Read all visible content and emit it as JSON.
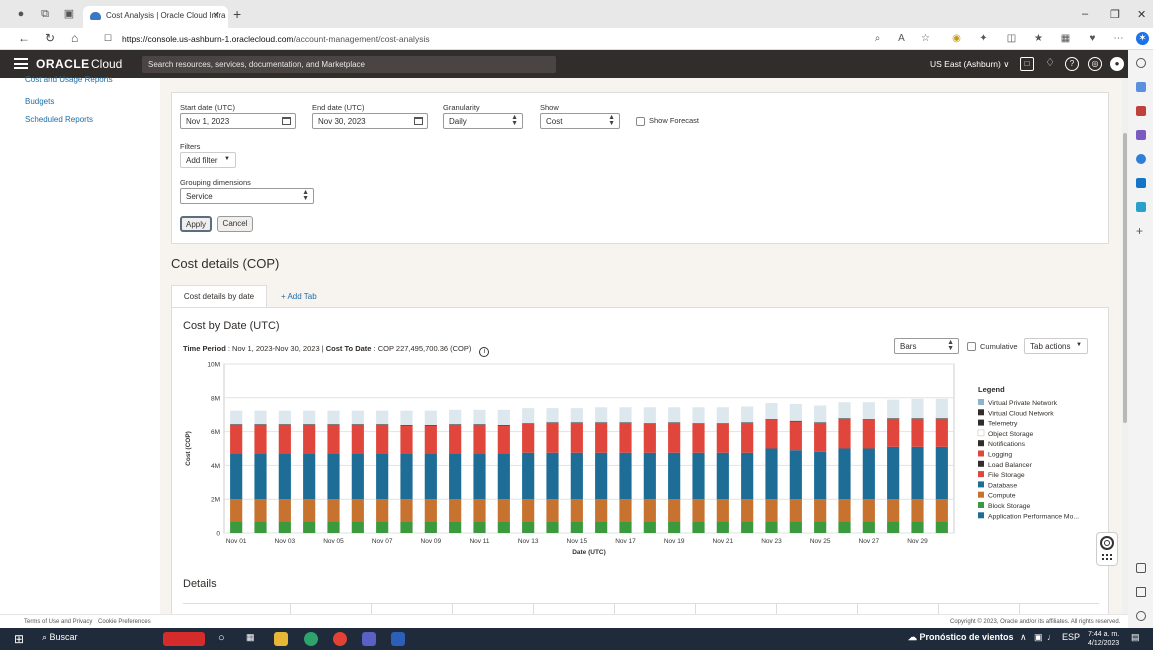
{
  "browser": {
    "tab_title": "Cost Analysis | Oracle Cloud Infra",
    "url_host": "https://console.us-ashburn-1.oraclecloud.com",
    "url_path": "/account-management/cost-analysis"
  },
  "header": {
    "brand": "ORACLE",
    "brand_suffix": "Cloud",
    "search_placeholder": "Search resources, services, documentation, and Marketplace",
    "region": "US East (Ashburn)"
  },
  "sidebar": {
    "items": [
      {
        "label": "Cost and Usage Reports"
      },
      {
        "label": "Budgets"
      },
      {
        "label": "Scheduled Reports"
      }
    ]
  },
  "filters": {
    "start_date_label": "Start date (UTC)",
    "start_date_value": "Nov 1, 2023",
    "end_date_label": "End date (UTC)",
    "end_date_value": "Nov 30, 2023",
    "granularity_label": "Granularity",
    "granularity_value": "Daily",
    "show_label": "Show",
    "show_value": "Cost",
    "show_forecast_label": "Show Forecast",
    "filters_label": "Filters",
    "add_filter_label": "Add filter",
    "grouping_label": "Grouping dimensions",
    "grouping_value": "Service",
    "apply_label": "Apply",
    "cancel_label": "Cancel"
  },
  "cost_details": {
    "title": "Cost details (COP)",
    "tab_label": "Cost details by date",
    "add_tab_label": "+ Add Tab",
    "chart_title": "Cost by Date (UTC)",
    "time_period_label": "Time Period",
    "time_period_value": ": Nov 1, 2023-Nov 30, 2023 |",
    "cost_to_date_label": "Cost To Date",
    "cost_to_date_value": ": COP 227,495,700.36 (COP)",
    "chart_type_value": "Bars",
    "cumulative_label": "Cumulative",
    "tab_actions_label": "Tab actions",
    "details_title": "Details"
  },
  "chart_data": {
    "type": "bar",
    "stacked": true,
    "title": "",
    "xlabel": "Date (UTC)",
    "ylabel": "Cost (COP)",
    "ylim": [
      0,
      10000000
    ],
    "yticks": [
      "0",
      "2M",
      "4M",
      "6M",
      "8M",
      "10M"
    ],
    "xtick_labels": [
      "Nov 01",
      "Nov 03",
      "Nov 05",
      "Nov 07",
      "Nov 09",
      "Nov 11",
      "Nov 13",
      "Nov 15",
      "Nov 17",
      "Nov 19",
      "Nov 21",
      "Nov 23",
      "Nov 25",
      "Nov 27",
      "Nov 29"
    ],
    "legend_title": "Legend",
    "legend_position": "right",
    "categories": [
      "Nov 01",
      "Nov 02",
      "Nov 03",
      "Nov 04",
      "Nov 05",
      "Nov 06",
      "Nov 07",
      "Nov 08",
      "Nov 09",
      "Nov 10",
      "Nov 11",
      "Nov 12",
      "Nov 13",
      "Nov 14",
      "Nov 15",
      "Nov 16",
      "Nov 17",
      "Nov 18",
      "Nov 19",
      "Nov 20",
      "Nov 21",
      "Nov 22",
      "Nov 23",
      "Nov 24",
      "Nov 25",
      "Nov 26",
      "Nov 27",
      "Nov 28",
      "Nov 29",
      "Nov 30"
    ],
    "series": [
      {
        "name": "Block Storage",
        "color": "#3c9a3e",
        "values": [
          700000,
          700000,
          700000,
          700000,
          700000,
          700000,
          700000,
          700000,
          700000,
          700000,
          700000,
          700000,
          700000,
          700000,
          700000,
          700000,
          700000,
          700000,
          700000,
          700000,
          700000,
          700000,
          700000,
          700000,
          700000,
          700000,
          700000,
          700000,
          700000,
          700000
        ]
      },
      {
        "name": "Compute",
        "color": "#c8722f",
        "values": [
          1300000,
          1300000,
          1300000,
          1300000,
          1300000,
          1300000,
          1300000,
          1300000,
          1300000,
          1300000,
          1300000,
          1300000,
          1300000,
          1300000,
          1300000,
          1300000,
          1300000,
          1300000,
          1300000,
          1300000,
          1300000,
          1300000,
          1300000,
          1300000,
          1300000,
          1300000,
          1300000,
          1300000,
          1300000,
          1300000
        ]
      },
      {
        "name": "Database",
        "color": "#1e6d97",
        "values": [
          2700000,
          2700000,
          2700000,
          2700000,
          2700000,
          2700000,
          2700000,
          2700000,
          2700000,
          2700000,
          2700000,
          2700000,
          2750000,
          2750000,
          2750000,
          2750000,
          2750000,
          2750000,
          2750000,
          2750000,
          2750000,
          2750000,
          3000000,
          2900000,
          2800000,
          3000000,
          3000000,
          3100000,
          3100000,
          3100000
        ]
      },
      {
        "name": "File Storage",
        "color": "#e0463b",
        "values": [
          1700000,
          1700000,
          1700000,
          1700000,
          1700000,
          1700000,
          1700000,
          1650000,
          1650000,
          1700000,
          1700000,
          1650000,
          1700000,
          1750000,
          1750000,
          1750000,
          1750000,
          1700000,
          1750000,
          1700000,
          1700000,
          1750000,
          1700000,
          1700000,
          1700000,
          1750000,
          1700000,
          1650000,
          1650000,
          1650000
        ]
      },
      {
        "name": "Load Balancer",
        "color": "#312d2a",
        "values": [
          40000,
          40000,
          40000,
          40000,
          40000,
          40000,
          40000,
          40000,
          40000,
          40000,
          40000,
          40000,
          40000,
          40000,
          40000,
          40000,
          40000,
          40000,
          40000,
          40000,
          40000,
          40000,
          40000,
          40000,
          40000,
          40000,
          40000,
          40000,
          40000,
          40000
        ]
      },
      {
        "name": "Virtual Private Network",
        "color": "#dde7ee",
        "values": [
          800000,
          800000,
          800000,
          800000,
          800000,
          800000,
          800000,
          850000,
          850000,
          850000,
          850000,
          900000,
          900000,
          850000,
          850000,
          900000,
          900000,
          950000,
          900000,
          950000,
          950000,
          950000,
          950000,
          1000000,
          1000000,
          950000,
          1000000,
          1100000,
          1150000,
          1150000
        ]
      }
    ],
    "legend": [
      {
        "name": "Virtual Private Network",
        "color": "#8fb3c9"
      },
      {
        "name": "Virtual Cloud Network",
        "color": "#312d2a"
      },
      {
        "name": "Telemetry",
        "color": "#312d2a"
      },
      {
        "name": "Object Storage",
        "color": "#ffffff"
      },
      {
        "name": "Notifications",
        "color": "#312d2a"
      },
      {
        "name": "Logging",
        "color": "#e0463b"
      },
      {
        "name": "Load Balancer",
        "color": "#312d2a"
      },
      {
        "name": "File Storage",
        "color": "#e0463b"
      },
      {
        "name": "Database",
        "color": "#1e6d97"
      },
      {
        "name": "Compute",
        "color": "#c8722f"
      },
      {
        "name": "Block Storage",
        "color": "#3c9a3e"
      },
      {
        "name": "Application Performance Mo...",
        "color": "#1e6d97"
      }
    ]
  },
  "footer": {
    "terms": "Terms of Use and Privacy",
    "cookies": "Cookie Preferences",
    "copyright": "Copyright © 2023, Oracle and/or its affiliates. All rights reserved."
  },
  "taskbar": {
    "search_label": "Buscar",
    "weather": "Pronóstico de vientos",
    "lang": "ESP",
    "time": "7:44 a. m.",
    "date": "4/12/2023"
  }
}
